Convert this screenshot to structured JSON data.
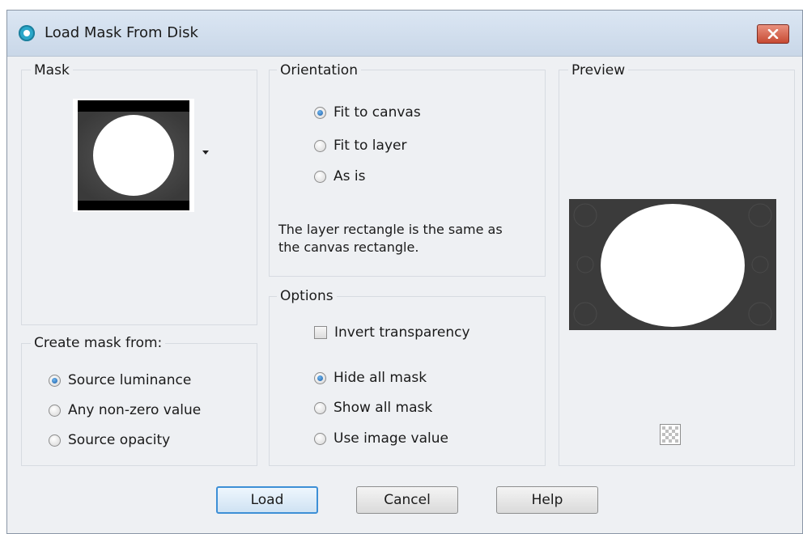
{
  "window": {
    "title": "Load Mask From Disk",
    "app_icon": "psp-app-icon",
    "close_icon": "close-icon"
  },
  "mask": {
    "group_title": "Mask"
  },
  "create_mask_from": {
    "group_title": "Create mask from:",
    "options": [
      "Source luminance",
      "Any non-zero value",
      "Source opacity"
    ],
    "selected": "Source luminance"
  },
  "orientation": {
    "group_title": "Orientation",
    "options": [
      "Fit to canvas",
      "Fit to layer",
      "As is"
    ],
    "selected": "Fit to canvas",
    "description_line1": "The layer rectangle is the same as",
    "description_line2": "the canvas rectangle."
  },
  "options": {
    "group_title": "Options",
    "invert_transparency": "Invert transparency",
    "invert_checked": false,
    "display_options": [
      "Hide all mask",
      "Show all mask",
      "Use image value"
    ],
    "selected": "Hide all mask"
  },
  "preview": {
    "group_title": "Preview"
  },
  "buttons": {
    "load": "Load",
    "cancel": "Cancel",
    "help": "Help"
  },
  "colors": {
    "dialog_bg": "#eef0f3",
    "accent": "#3d8fd6",
    "close_button": "#c74a33"
  }
}
